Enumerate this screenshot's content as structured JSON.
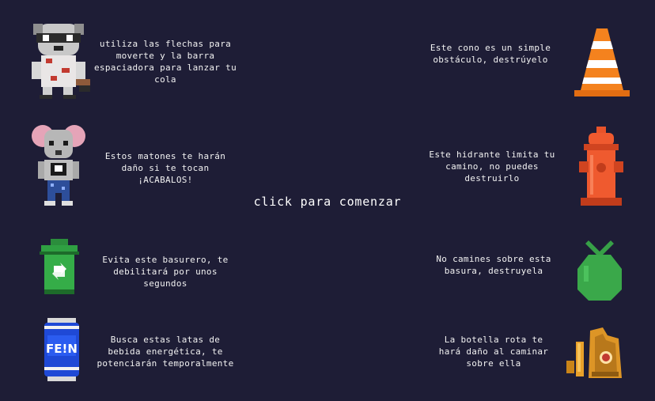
{
  "screen": {
    "prompt": "click para comenzar"
  },
  "left": [
    {
      "icon": "raccoon-icon",
      "text": "utiliza las flechas para moverte y la barra espaciadora para lanzar tu cola"
    },
    {
      "icon": "mouse-thug-icon",
      "text": "Estos matones te harán daño si te tocan ¡ACABALOS!"
    },
    {
      "icon": "trash-bin-icon",
      "text": "Evita este basurero, te debilitará por unos segundos"
    },
    {
      "icon": "energy-can-icon",
      "text": "Busca estas latas de bebida energética, te potenciarán temporalmente"
    }
  ],
  "right": [
    {
      "icon": "traffic-cone-icon",
      "text": "Este cono es un simple obstáculo, destrúyelo"
    },
    {
      "icon": "fire-hydrant-icon",
      "text": "Este hidrante limita tu camino, no puedes destruirlo"
    },
    {
      "icon": "garbage-bag-icon",
      "text": "No camines sobre esta basura, destruyela"
    },
    {
      "icon": "broken-bottle-icon",
      "text": "La botella rota te hará daño al caminar sobre ella"
    }
  ],
  "can_label": "FE!N"
}
